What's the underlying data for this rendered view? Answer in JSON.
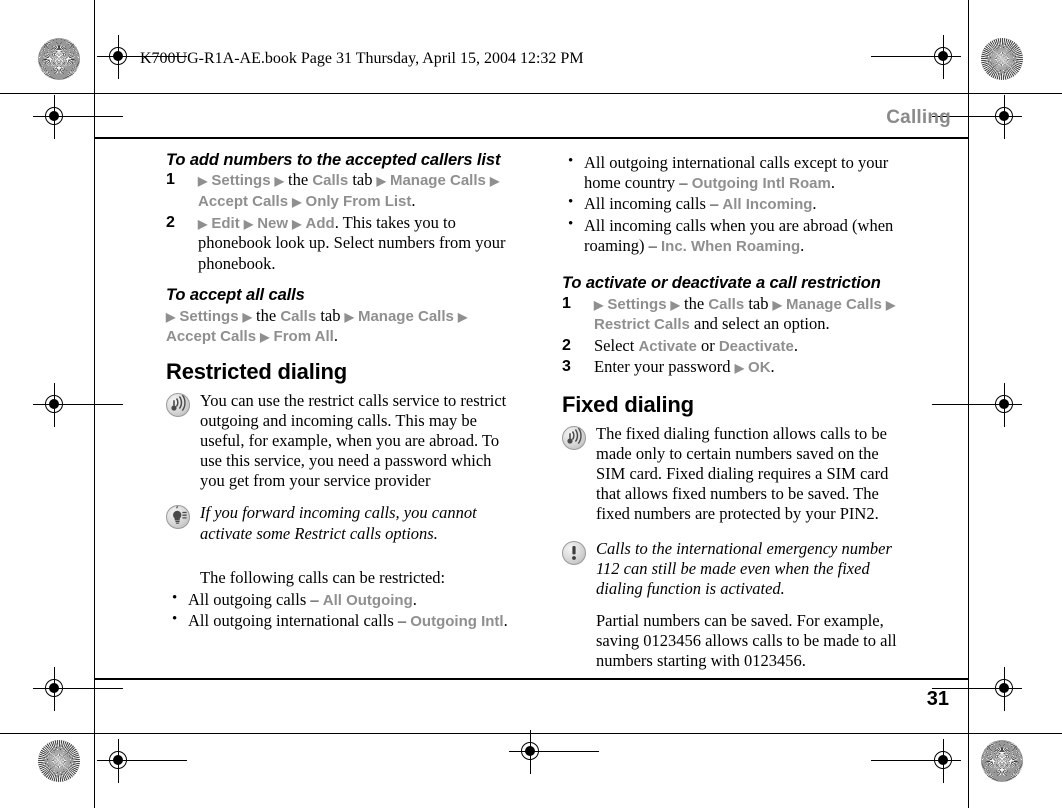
{
  "document": {
    "header_line": "K700UG-R1A-AE.book  Page 31  Thursday, April 15, 2004  12:32 PM",
    "running_head": "Calling",
    "page_number": "31"
  },
  "colors": {
    "ui_term": "#8f8f8f",
    "body_text": "#000000",
    "running_head": "#8a8a8a"
  },
  "icons": {
    "signal": "signal-waves-icon",
    "tip": "lightbulb-tip-icon",
    "warning": "exclamation-warning-icon"
  },
  "left_column": {
    "proc1": {
      "heading": "To add numbers to the accepted callers list",
      "steps": [
        {
          "num": "1",
          "parts": [
            {
              "t": "arrow",
              "v": "▶"
            },
            {
              "t": "ui",
              "v": "Settings"
            },
            {
              "t": "arrow",
              "v": "▶"
            },
            {
              "t": "plain",
              "v": "the"
            },
            {
              "t": "ui",
              "v": "Calls"
            },
            {
              "t": "plain",
              "v": "tab"
            },
            {
              "t": "arrow",
              "v": "▶"
            },
            {
              "t": "ui",
              "v": "Manage Calls"
            },
            {
              "t": "arrow",
              "v": "▶"
            },
            {
              "t": "ui",
              "v": "Accept Calls"
            },
            {
              "t": "arrow",
              "v": "▶"
            },
            {
              "t": "ui",
              "v": "Only From List"
            },
            {
              "t": "plain",
              "v": "."
            }
          ]
        },
        {
          "num": "2",
          "parts": [
            {
              "t": "arrow",
              "v": "▶"
            },
            {
              "t": "ui",
              "v": "Edit"
            },
            {
              "t": "arrow",
              "v": "▶"
            },
            {
              "t": "ui",
              "v": "New"
            },
            {
              "t": "arrow",
              "v": "▶"
            },
            {
              "t": "ui",
              "v": "Add"
            },
            {
              "t": "plain",
              "v": ". This takes you to phonebook look up. Select numbers from your phonebook."
            }
          ]
        }
      ]
    },
    "proc2": {
      "heading": "To accept all calls",
      "line_parts": [
        {
          "t": "arrow",
          "v": "▶"
        },
        {
          "t": "ui",
          "v": "Settings"
        },
        {
          "t": "arrow",
          "v": "▶"
        },
        {
          "t": "plain",
          "v": "the"
        },
        {
          "t": "ui",
          "v": "Calls"
        },
        {
          "t": "plain",
          "v": "tab"
        },
        {
          "t": "arrow",
          "v": "▶"
        },
        {
          "t": "ui",
          "v": "Manage Calls"
        },
        {
          "t": "arrow",
          "v": "▶"
        },
        {
          "t": "ui",
          "v": "Accept Calls"
        },
        {
          "t": "arrow",
          "v": "▶"
        },
        {
          "t": "ui",
          "v": "From All"
        },
        {
          "t": "plain",
          "v": "."
        }
      ]
    },
    "section_heading": "Restricted dialing",
    "note_signal": "You can use the restrict calls service to restrict outgoing and incoming calls. This may be useful, for example, when you are abroad. To use this service, you need a password which you get from your service provider",
    "note_tip": "If you forward incoming calls, you cannot activate some Restrict calls options.",
    "intro": "The following calls can be restricted:",
    "bullets": [
      {
        "text": "All outgoing calls – ",
        "term": "All Outgoing",
        "tail": "."
      },
      {
        "text": "All outgoing international calls – ",
        "term": "Outgoing Intl",
        "tail": "."
      }
    ]
  },
  "right_column": {
    "bullets": [
      {
        "text": "All outgoing international calls except to your home country – ",
        "term": "Outgoing Intl Roam",
        "tail": "."
      },
      {
        "text": "All incoming calls – ",
        "term": "All Incoming",
        "tail": "."
      },
      {
        "text": "All incoming calls when you are abroad (when roaming) – ",
        "term": "Inc. When Roaming",
        "tail": "."
      }
    ],
    "proc1": {
      "heading": "To activate or deactivate a call restriction",
      "steps": [
        {
          "num": "1",
          "parts": [
            {
              "t": "arrow",
              "v": "▶"
            },
            {
              "t": "ui",
              "v": "Settings"
            },
            {
              "t": "arrow",
              "v": "▶"
            },
            {
              "t": "plain",
              "v": "the"
            },
            {
              "t": "ui",
              "v": "Calls"
            },
            {
              "t": "plain",
              "v": "tab"
            },
            {
              "t": "arrow",
              "v": "▶"
            },
            {
              "t": "ui",
              "v": "Manage Calls"
            },
            {
              "t": "arrow",
              "v": "▶"
            },
            {
              "t": "ui",
              "v": "Restrict Calls"
            },
            {
              "t": "plain",
              "v": "and select an option."
            }
          ]
        },
        {
          "num": "2",
          "parts": [
            {
              "t": "plain",
              "v": "Select"
            },
            {
              "t": "ui",
              "v": "Activate"
            },
            {
              "t": "plain",
              "v": "or"
            },
            {
              "t": "ui",
              "v": "Deactivate"
            },
            {
              "t": "plain",
              "v": "."
            }
          ]
        },
        {
          "num": "3",
          "parts": [
            {
              "t": "plain",
              "v": "Enter your password"
            },
            {
              "t": "arrow",
              "v": "▶"
            },
            {
              "t": "ui",
              "v": "OK"
            },
            {
              "t": "plain",
              "v": "."
            }
          ]
        }
      ]
    },
    "section_heading": "Fixed dialing",
    "note_signal": "The fixed dialing function allows calls to be made only to certain numbers saved on the SIM card. Fixed dialing requires a SIM card that allows fixed numbers to be saved. The fixed numbers are protected by your PIN2.",
    "note_warning": "Calls to the international emergency number 112 can still be made even when the fixed dialing function is activated.",
    "closing": "Partial numbers can be saved. For example, saving 0123456 allows calls to be made to all numbers starting with 0123456."
  }
}
